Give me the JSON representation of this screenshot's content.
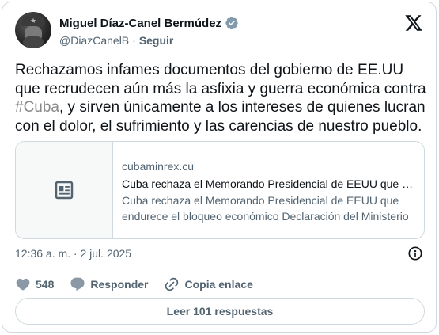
{
  "author": {
    "name": "Miguel Díaz-Canel Bermúdez",
    "handle": "@DiazCanelB",
    "separator": "·",
    "follow_label": "Seguir"
  },
  "icons": {
    "verified": "verified-badge-icon",
    "brand": "x-logo-icon",
    "link_thumb": "article-icon",
    "info": "info-icon",
    "like": "heart-icon",
    "reply": "speech-bubble-icon",
    "copy": "link-icon"
  },
  "post": {
    "text_before": "Rechazamos infames documentos del gobierno de EE.UU que recrudecen aún más la asfixia y guerra económica contra ",
    "hashtag": "#Cuba",
    "text_after": ", y sirven únicamente a los intereses de quienes lucran con el dolor, el sufrimiento y las carencias de nuestro pueblo."
  },
  "link_card": {
    "domain": "cubaminrex.cu",
    "title": "Cuba rechaza el Memorando Presidencial de EEUU que endurece el bloqueo económico",
    "description": "Cuba rechaza el Memorando Presidencial de EEUU que endurece el bloqueo económico Declaración del Ministerio de Relaciones Exteriores"
  },
  "meta": {
    "timestamp": "12:36 a. m. · 2 jul. 2025"
  },
  "actions": {
    "likes": "548",
    "reply_label": "Responder",
    "copy_label": "Copia enlace"
  },
  "replies_button": "Leer 101 respuestas",
  "colors": {
    "text": "#0f1419",
    "secondary": "#536471",
    "border": "#cfd9de",
    "hashtag": "#8a8a8a"
  }
}
